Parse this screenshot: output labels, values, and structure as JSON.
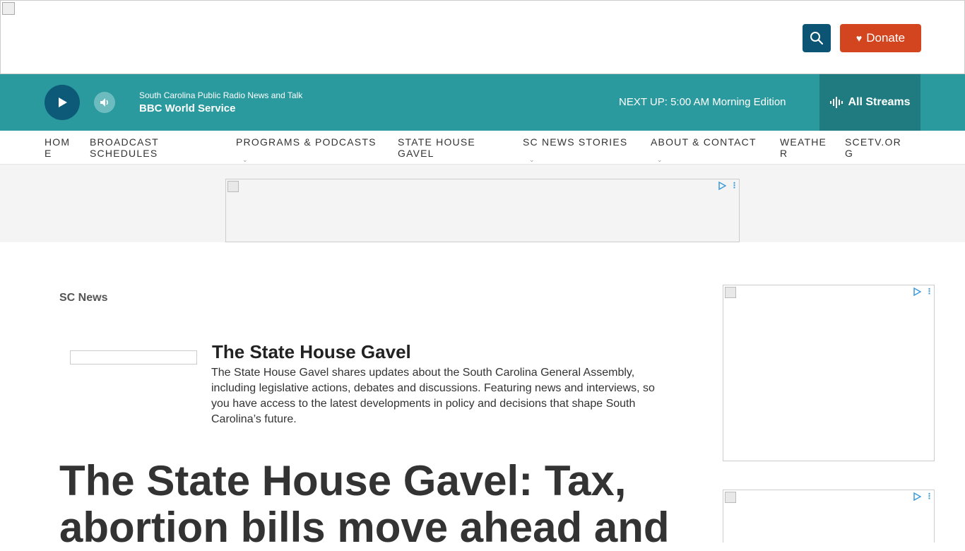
{
  "header": {
    "donate_label": "Donate",
    "icons": {
      "search": "search-icon",
      "donate": "heart-icon"
    }
  },
  "player": {
    "station": "South Carolina Public Radio News and Talk",
    "program": "BBC World Service",
    "next_up": "NEXT UP: 5:00 AM Morning Edition",
    "all_streams_label": "All Streams",
    "icons": {
      "play": "play-icon",
      "volume": "volume-icon",
      "streams": "audio-wave-icon"
    }
  },
  "nav": {
    "items": [
      {
        "label": "HOM\nE",
        "dropdown": false
      },
      {
        "label": "BROADCAST\nSCHEDULES",
        "dropdown": false
      },
      {
        "label": "PROGRAMS & PODCASTS",
        "dropdown": true
      },
      {
        "label": "STATE HOUSE\nGAVEL",
        "dropdown": false
      },
      {
        "label": "SC NEWS STORIES",
        "dropdown": true
      },
      {
        "label": "ABOUT & CONTACT",
        "dropdown": true
      },
      {
        "label": "WEATHE\nR",
        "dropdown": false
      },
      {
        "label": "SCETV.OR\nG",
        "dropdown": false
      }
    ]
  },
  "content": {
    "section_label": "SC News",
    "promo": {
      "title": "The State House Gavel",
      "description": "The State House Gavel shares updates about the South Carolina General Assembly, including legislative actions, debates and discussions. Featuring news and interviews, so you have access to the latest developments in policy and decisions that shape South Carolina’s future."
    },
    "headline": "The State House Gavel: Tax, abortion bills move ahead and"
  },
  "colors": {
    "player_bg": "#2a9a9e",
    "streams_bg": "#1f7b80",
    "play_bg": "#0c5a78",
    "search_bg": "#0b5474",
    "donate_bg": "#d2451e"
  }
}
